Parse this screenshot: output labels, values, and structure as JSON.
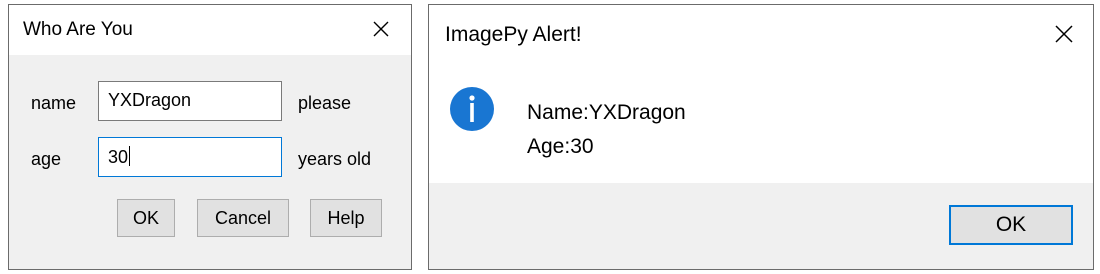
{
  "who_dialog": {
    "title": "Who Are You",
    "name_label": "name",
    "name_value": "YXDragon",
    "name_suffix": "please",
    "age_label": "age",
    "age_value": "30",
    "age_suffix": "years old",
    "ok_label": "OK",
    "cancel_label": "Cancel",
    "help_label": "Help",
    "close_icon": "close-icon"
  },
  "alert_dialog": {
    "title": "ImagePy Alert!",
    "message_line1": "Name:YXDragon",
    "message_line2": "Age:30",
    "ok_label": "OK",
    "info_icon": "info-icon",
    "close_icon": "close-icon",
    "icon_color": "#1976d2",
    "focus_color": "#0078d7"
  }
}
